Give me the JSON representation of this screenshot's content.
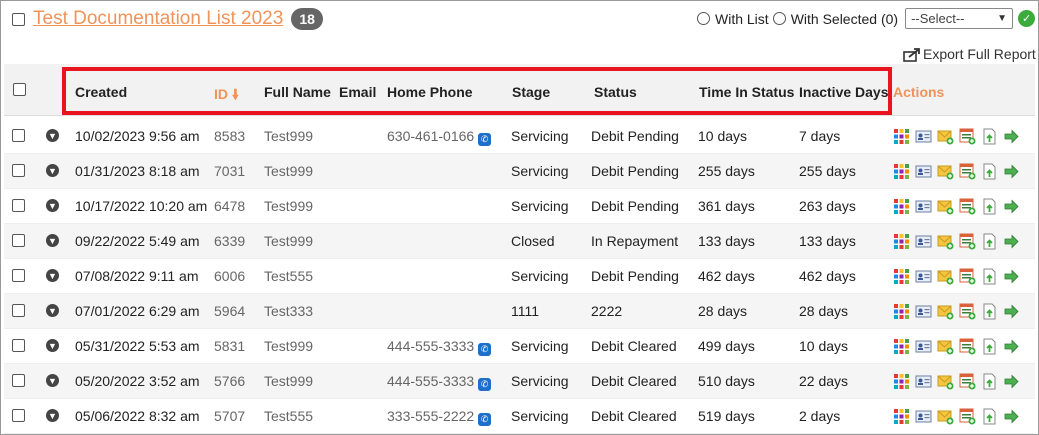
{
  "list": {
    "title": "Test Documentation List 2023",
    "count": "18"
  },
  "controls": {
    "with_list": "With List",
    "with_selected": "With Selected (0)",
    "select_value": "--Select--",
    "export_label": "Export Full Report"
  },
  "columns": {
    "created": "Created",
    "id": "ID",
    "full_name": "Full Name",
    "email": "Email",
    "home_phone": "Home Phone",
    "stage": "Stage",
    "status": "Status",
    "time_in_status": "Time In Status",
    "inactive_days": "Inactive Days",
    "actions": "Actions"
  },
  "rows": [
    {
      "created": "10/02/2023 9:56 am",
      "id": "8583",
      "name": "Test999",
      "phone": "630-461-0166",
      "stage": "Servicing",
      "status": "Debit Pending",
      "time": "10 days",
      "inactive": "7 days"
    },
    {
      "created": "01/31/2023 8:18 am",
      "id": "7031",
      "name": "Test999",
      "phone": "",
      "stage": "Servicing",
      "status": "Debit Pending",
      "time": "255 days",
      "inactive": "255 days"
    },
    {
      "created": "10/17/2022 10:20 am",
      "id": "6478",
      "name": "Test999",
      "phone": "",
      "stage": "Servicing",
      "status": "Debit Pending",
      "time": "361 days",
      "inactive": "263 days"
    },
    {
      "created": "09/22/2022 5:49 am",
      "id": "6339",
      "name": "Test999",
      "phone": "",
      "stage": "Closed",
      "status": "In Repayment",
      "time": "133 days",
      "inactive": "133 days"
    },
    {
      "created": "07/08/2022 9:11 am",
      "id": "6006",
      "name": "Test555",
      "phone": "",
      "stage": "Servicing",
      "status": "Debit Pending",
      "time": "462 days",
      "inactive": "462 days"
    },
    {
      "created": "07/01/2022 6:29 am",
      "id": "5964",
      "name": "Test333",
      "phone": "",
      "stage": "1111",
      "status": "2222",
      "time": "28 days",
      "inactive": "28 days"
    },
    {
      "created": "05/31/2022 5:53 am",
      "id": "5831",
      "name": "Test999",
      "phone": "444-555-3333",
      "stage": "Servicing",
      "status": "Debit Cleared",
      "time": "499 days",
      "inactive": "10 days"
    },
    {
      "created": "05/20/2022 3:52 am",
      "id": "5766",
      "name": "Test999",
      "phone": "444-555-3333",
      "stage": "Servicing",
      "status": "Debit Cleared",
      "time": "510 days",
      "inactive": "22 days"
    },
    {
      "created": "05/06/2022 8:32 am",
      "id": "5707",
      "name": "Test555",
      "phone": "333-555-2222",
      "stage": "Servicing",
      "status": "Debit Cleared",
      "time": "519 days",
      "inactive": "2 days"
    }
  ],
  "colors": {
    "accent_orange": "#f0935a",
    "highlight_red": "#e8141e",
    "phone_blue": "#1e6fc9",
    "go_green": "#3cab3c"
  },
  "icons": {
    "row_actions": [
      "grid-icon",
      "contact-card-icon",
      "add-note-icon",
      "add-task-icon",
      "upload-document-icon",
      "forward-arrow-icon"
    ]
  }
}
